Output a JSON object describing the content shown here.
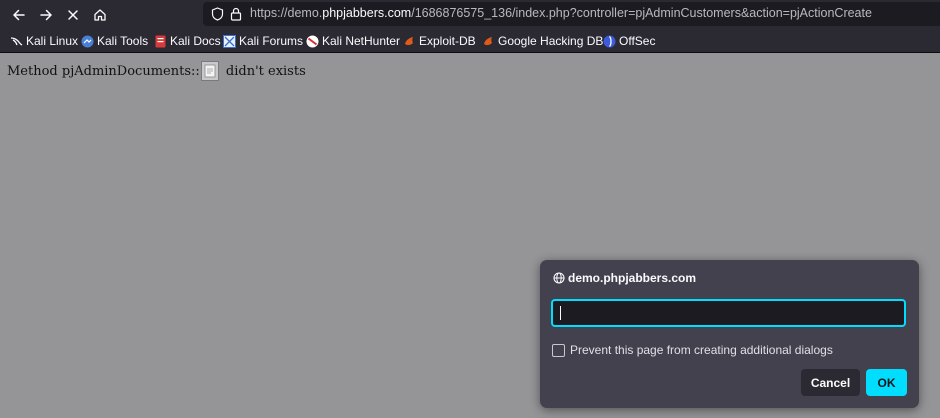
{
  "browser": {
    "url_prefix": "https://demo.",
    "url_host": "phpjabbers.com",
    "url_path": "/1686876575_136/index.php?controller=pjAdminCustomers&action=pjActionCreate"
  },
  "bookmarks": [
    {
      "label": "Kali Linux",
      "icon": "kali-dragon-icon"
    },
    {
      "label": "Kali Tools",
      "icon": "kali-tools-icon"
    },
    {
      "label": "Kali Docs",
      "icon": "kali-docs-icon"
    },
    {
      "label": "Kali Forums",
      "icon": "kali-forums-icon"
    },
    {
      "label": "Kali NetHunter",
      "icon": "nethunter-icon"
    },
    {
      "label": "Exploit-DB",
      "icon": "exploit-db-icon"
    },
    {
      "label": "Google Hacking DB",
      "icon": "ghdb-icon"
    },
    {
      "label": "OffSec",
      "icon": "offsec-icon"
    }
  ],
  "page": {
    "message_before": "Method pjAdminDocuments::",
    "message_after": " didn't exists"
  },
  "dialog": {
    "origin": "demo.phpjabbers.com",
    "input_value": "",
    "checkbox_label": "Prevent this page from creating additional dialogs",
    "cancel_label": "Cancel",
    "ok_label": "OK"
  },
  "colors": {
    "accent": "#00ddff",
    "toolbar": "#2b2a33",
    "dialog": "#42414d",
    "page_overlay": "#959496"
  }
}
